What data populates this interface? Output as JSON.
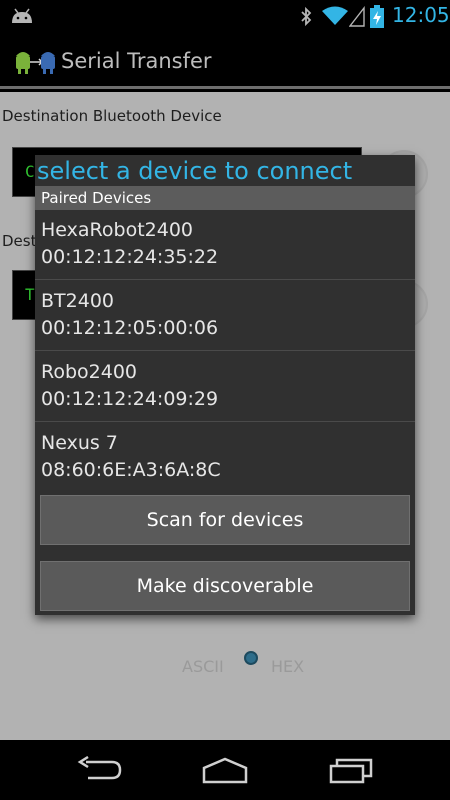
{
  "status_bar": {
    "time": "12:05",
    "icons": [
      "android-debug-icon",
      "bluetooth-icon",
      "wifi-icon",
      "signal-icon",
      "battery-charging-icon"
    ]
  },
  "action_bar": {
    "title": "Serial Transfer",
    "logo_icon": "android-logo-icon"
  },
  "content": {
    "destination_label": "Destination Bluetooth Device",
    "destination_value": "C",
    "second_label": "Dest",
    "second_value": "T",
    "radio": {
      "ascii_label": "ASCII",
      "hex_label": "HEX",
      "selected": "HEX"
    }
  },
  "dialog": {
    "title": "select a device to connect",
    "section_header": "Paired Devices",
    "devices": [
      {
        "name": "HexaRobot2400",
        "address": "00:12:12:24:35:22"
      },
      {
        "name": "BT2400",
        "address": "00:12:12:05:00:06"
      },
      {
        "name": "Robo2400",
        "address": "00:12:12:24:09:29"
      },
      {
        "name": "Nexus 7",
        "address": "08:60:6E:A3:6A:8C"
      }
    ],
    "scan_button": "Scan for devices",
    "discoverable_button": "Make discoverable"
  },
  "nav_bar": {
    "icons": [
      "back-icon",
      "home-icon",
      "recent-apps-icon"
    ]
  },
  "colors": {
    "accent": "#33b5e5",
    "dialog_bg": "#303030",
    "content_bg": "#b2b2b2"
  }
}
